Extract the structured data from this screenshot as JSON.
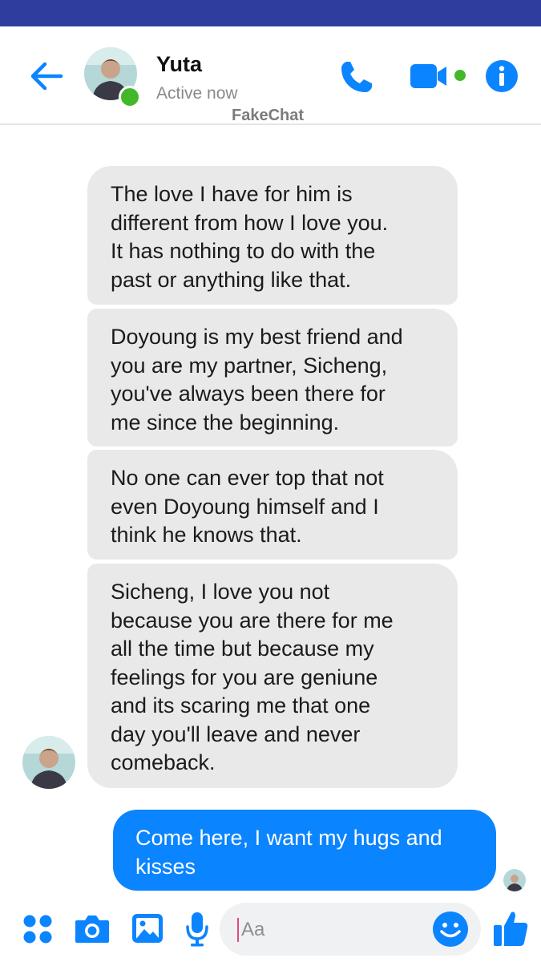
{
  "header": {
    "contact_name": "Yuta",
    "status": "Active now",
    "watermark": "FakeChat"
  },
  "messages": [
    {
      "direction": "incoming",
      "text": "The love I have for him is\ndifferent from how I love you.\nIt has nothing to do with the\npast or anything like that."
    },
    {
      "direction": "incoming",
      "text": "Doyoung is my best friend and\nyou are my partner, Sicheng,\nyou've always been there for\nme since the beginning."
    },
    {
      "direction": "incoming",
      "text": "No one can ever top that not\neven Doyoung himself and I\nthink he knows that."
    },
    {
      "direction": "incoming",
      "text": "Sicheng, I love you not\nbecause you are there for me\nall the time but because my\nfeelings for you are geniune\nand its scaring me that one\nday you'll leave and never\ncomeback."
    },
    {
      "direction": "outgoing",
      "text": "Come here, I want my hugs and kisses"
    }
  ],
  "composer": {
    "placeholder": "Aa"
  },
  "icons": {
    "back": "arrow-left-icon",
    "call": "phone-icon",
    "video": "video-camera-icon",
    "info": "info-icon",
    "menu": "four-dots-icon",
    "camera": "camera-icon",
    "gallery": "image-icon",
    "mic": "microphone-icon",
    "emoji": "smiley-icon",
    "like": "thumbs-up-icon"
  },
  "colors": {
    "accent": "#0b84ff",
    "status_bar": "#2f3e9e",
    "online": "#42b72a",
    "incoming_bubble": "#e9e9e9"
  }
}
